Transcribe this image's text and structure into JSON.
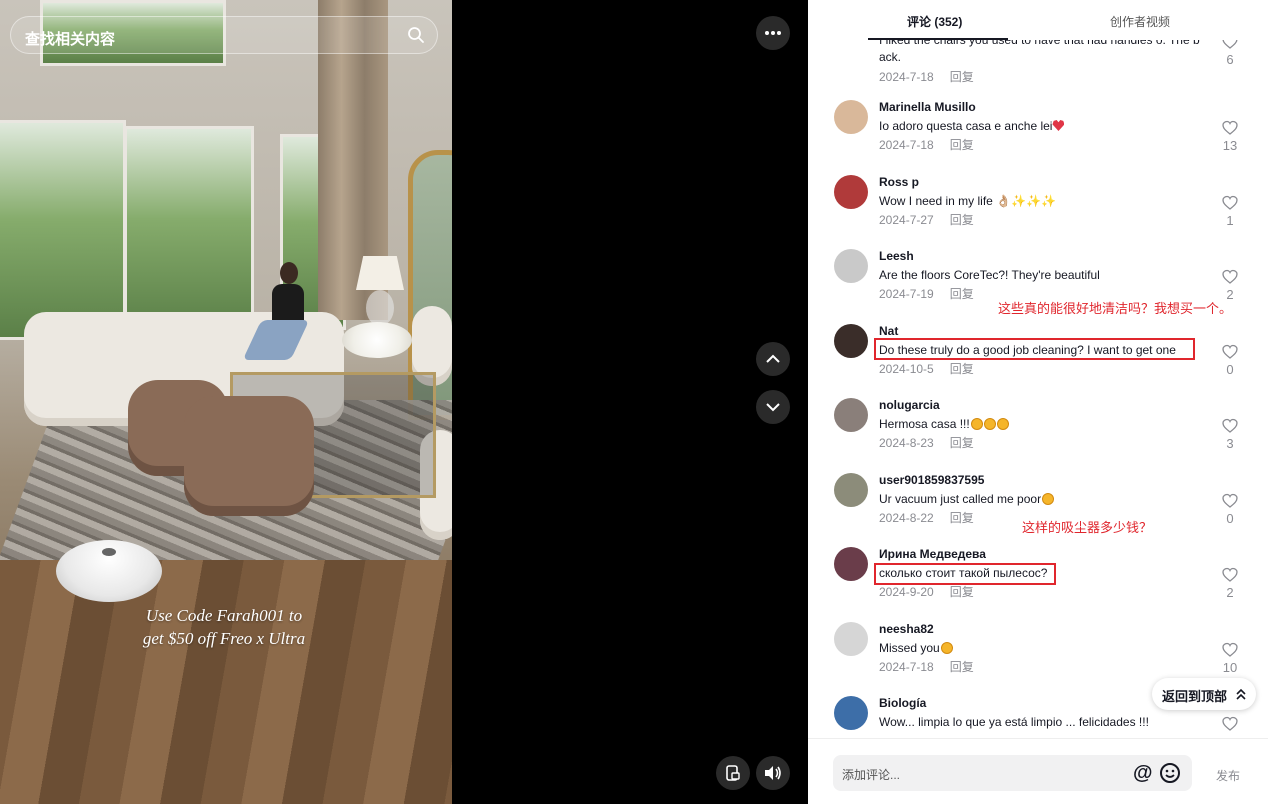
{
  "search": {
    "placeholder": "查找相关内容"
  },
  "video": {
    "promo_line1": "Use Code Farah001 to",
    "promo_line2": "get $50 off Freo x Ultra"
  },
  "tabs": {
    "comments": "评论 (352)",
    "creator_videos": "创作者视频"
  },
  "reply_label": "回复",
  "comments": [
    {
      "user": "",
      "text": "I liked the chairs you used to have that had handles o. The b ack.",
      "date": "2024-7-18",
      "likes": "6"
    },
    {
      "user": "Marinella Musillo",
      "text": "Io adoro questa casa e anche lei",
      "date": "2024-7-18",
      "likes": "13",
      "emoji": "heart"
    },
    {
      "user": "Ross p",
      "text": "Wow I need in my life 👌🏼✨✨✨",
      "date": "2024-7-27",
      "likes": "1"
    },
    {
      "user": "Leesh",
      "text": "Are the floors CoreTec?! They're beautiful",
      "date": "2024-7-19",
      "likes": "2"
    },
    {
      "user": "Nat",
      "text": "Do these truly do a good job cleaning? I want to get one",
      "date": "2024-10-5",
      "likes": "0"
    },
    {
      "user": "nolugarcia",
      "text": "Hermosa casa !!!",
      "date": "2024-8-23",
      "likes": "3",
      "emoji": "face3"
    },
    {
      "user": "user901859837595",
      "text": "Ur vacuum just called me poor",
      "date": "2024-8-22",
      "likes": "0",
      "emoji": "face1"
    },
    {
      "user": "Ирина Медведева",
      "text": "сколько стоит такой пылесос?",
      "date": "2024-9-20",
      "likes": "2"
    },
    {
      "user": "neesha82",
      "text": "Missed you",
      "date": "2024-7-18",
      "likes": "10",
      "emoji": "face1"
    },
    {
      "user": "Biología",
      "text": "Wow... limpia lo que ya está limpio ... felicidades !!!",
      "date": "",
      "likes": ""
    }
  ],
  "annotations": {
    "nat_translation": "这些真的能很好地清洁吗？我想买一个。",
    "irina_translation": "这样的吸尘器多少钱？"
  },
  "back_to_top": "返回到顶部",
  "bottom": {
    "input_placeholder": "添加评论...",
    "at_symbol": "@",
    "publish": "发布"
  },
  "colors": {
    "highlight": "#e0262d",
    "text": "#161823",
    "muted": "#8a8b91"
  },
  "icons": {
    "more": "more-icon",
    "up": "chevron-up-icon",
    "down": "chevron-down-icon",
    "pip": "pip-icon",
    "volume": "volume-icon",
    "heart": "heart-icon",
    "emoji": "emoji-icon"
  }
}
